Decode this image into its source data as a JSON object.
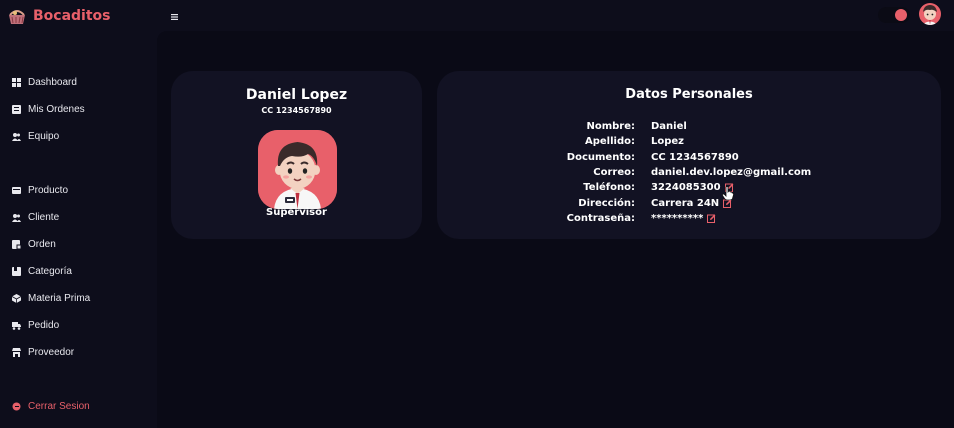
{
  "app": {
    "name": "Bocaditos"
  },
  "sidebar": {
    "items": [
      {
        "label": "Dashboard",
        "icon": "dashboard-icon"
      },
      {
        "label": "Mis Ordenes",
        "icon": "orders-icon"
      },
      {
        "label": "Equipo",
        "icon": "team-icon"
      },
      {
        "label": "Producto",
        "icon": "product-icon"
      },
      {
        "label": "Cliente",
        "icon": "client-icon"
      },
      {
        "label": "Orden",
        "icon": "order-icon"
      },
      {
        "label": "Categoría",
        "icon": "category-icon"
      },
      {
        "label": "Materia Prima",
        "icon": "raw-material-icon"
      },
      {
        "label": "Pedido",
        "icon": "truck-icon"
      },
      {
        "label": "Proveedor",
        "icon": "store-icon"
      }
    ],
    "logout": {
      "label": "Cerrar Sesion",
      "icon": "logout-icon"
    }
  },
  "profile": {
    "name": "Daniel Lopez",
    "document": "CC 1234567890",
    "role": "Supervisor"
  },
  "personal": {
    "title": "Datos Personales",
    "fields": {
      "nombre": {
        "label": "Nombre:",
        "value": "Daniel"
      },
      "apellido": {
        "label": "Apellido:",
        "value": "Lopez"
      },
      "documento": {
        "label": "Documento:",
        "value": "CC 1234567890"
      },
      "correo": {
        "label": "Correo:",
        "value": "daniel.dev.lopez@gmail.com"
      },
      "telefono": {
        "label": "Teléfono:",
        "value": "3224085300"
      },
      "direccion": {
        "label": "Dirección:",
        "value": "Carrera 24N"
      },
      "contrasena": {
        "label": "Contraseña:",
        "value": "**********"
      }
    }
  },
  "colors": {
    "accent": "#e8606a",
    "background": "#0d0d1b",
    "card": "#121223"
  }
}
